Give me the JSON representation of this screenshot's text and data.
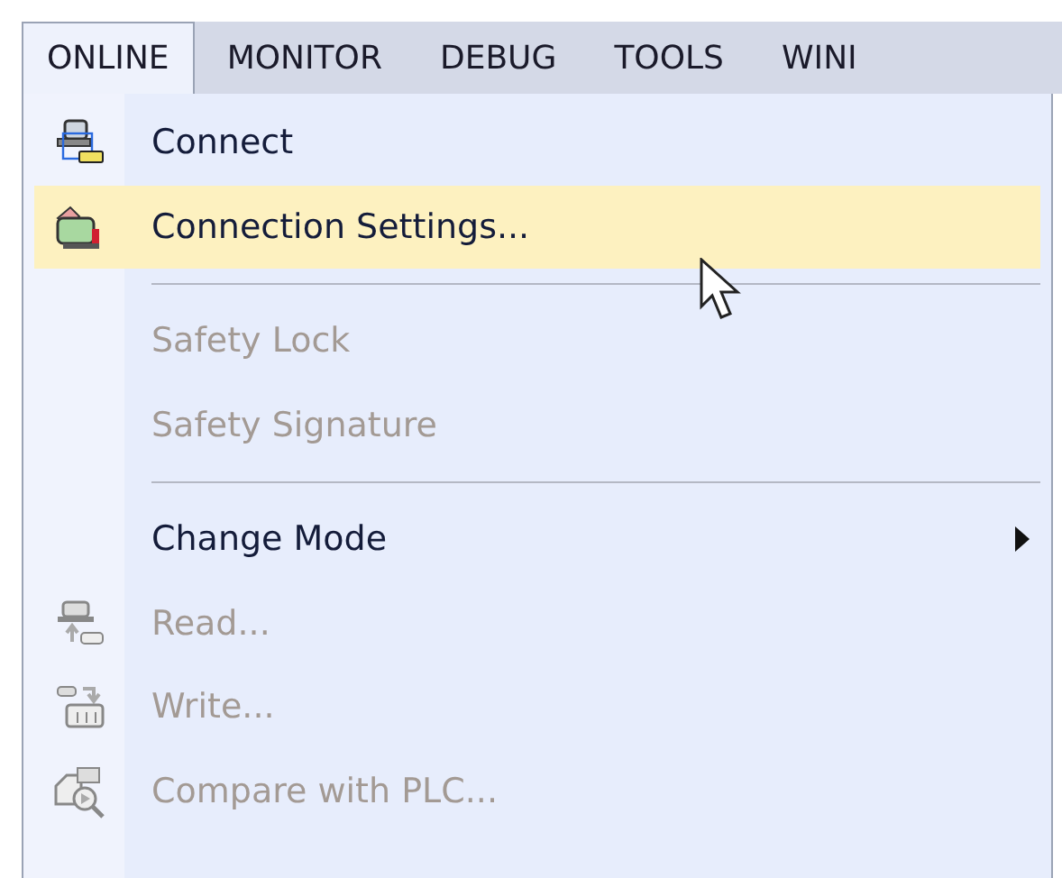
{
  "menubar": [
    {
      "label": "ONLINE",
      "selected": true
    },
    {
      "label": "MONITOR",
      "selected": false
    },
    {
      "label": "DEBUG",
      "selected": false
    },
    {
      "label": "TOOLS",
      "selected": false
    },
    {
      "label": "WINI",
      "selected": false
    }
  ],
  "menu": [
    {
      "kind": "item",
      "label": "Connect",
      "disabled": false,
      "highlighted": false
    },
    {
      "kind": "item",
      "label": "Connection Settings...",
      "disabled": false,
      "highlighted": true
    },
    {
      "kind": "separator"
    },
    {
      "kind": "item",
      "label": "Safety Lock",
      "disabled": true,
      "highlighted": false
    },
    {
      "kind": "item",
      "label": "Safety Signature",
      "disabled": true,
      "highlighted": false
    },
    {
      "kind": "separator"
    },
    {
      "kind": "submenu",
      "label": "Change Mode",
      "disabled": false,
      "highlighted": false
    },
    {
      "kind": "item",
      "label": "Read...",
      "disabled": true,
      "highlighted": false
    },
    {
      "kind": "item",
      "label": "Write...",
      "disabled": true,
      "highlighted": false
    },
    {
      "kind": "item",
      "label": "Compare with PLC...",
      "disabled": true,
      "highlighted": false
    }
  ]
}
